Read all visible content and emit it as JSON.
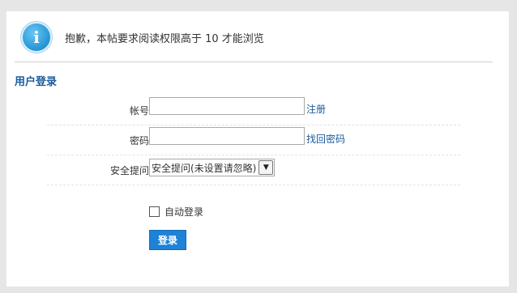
{
  "notice": {
    "icon": "info-icon",
    "icon_glyph": "i",
    "message": "抱歉，本帖要求阅读权限高于 10 才能浏览"
  },
  "login": {
    "title": "用户登录",
    "account_label": "帐号:",
    "account_value": "",
    "register_link": "注册",
    "password_label": "密码:",
    "password_value": "",
    "recover_link": "找回密码",
    "question_label": "安全提问:",
    "question_selected": "安全提问(未设置请忽略)",
    "autologin_label": "自动登录",
    "autologin_checked": false,
    "submit_label": "登录"
  },
  "colors": {
    "background": "#e6e6e6",
    "link": "#1a5a9b",
    "button": "#1e82d6",
    "icon": "#2d9bd9"
  }
}
